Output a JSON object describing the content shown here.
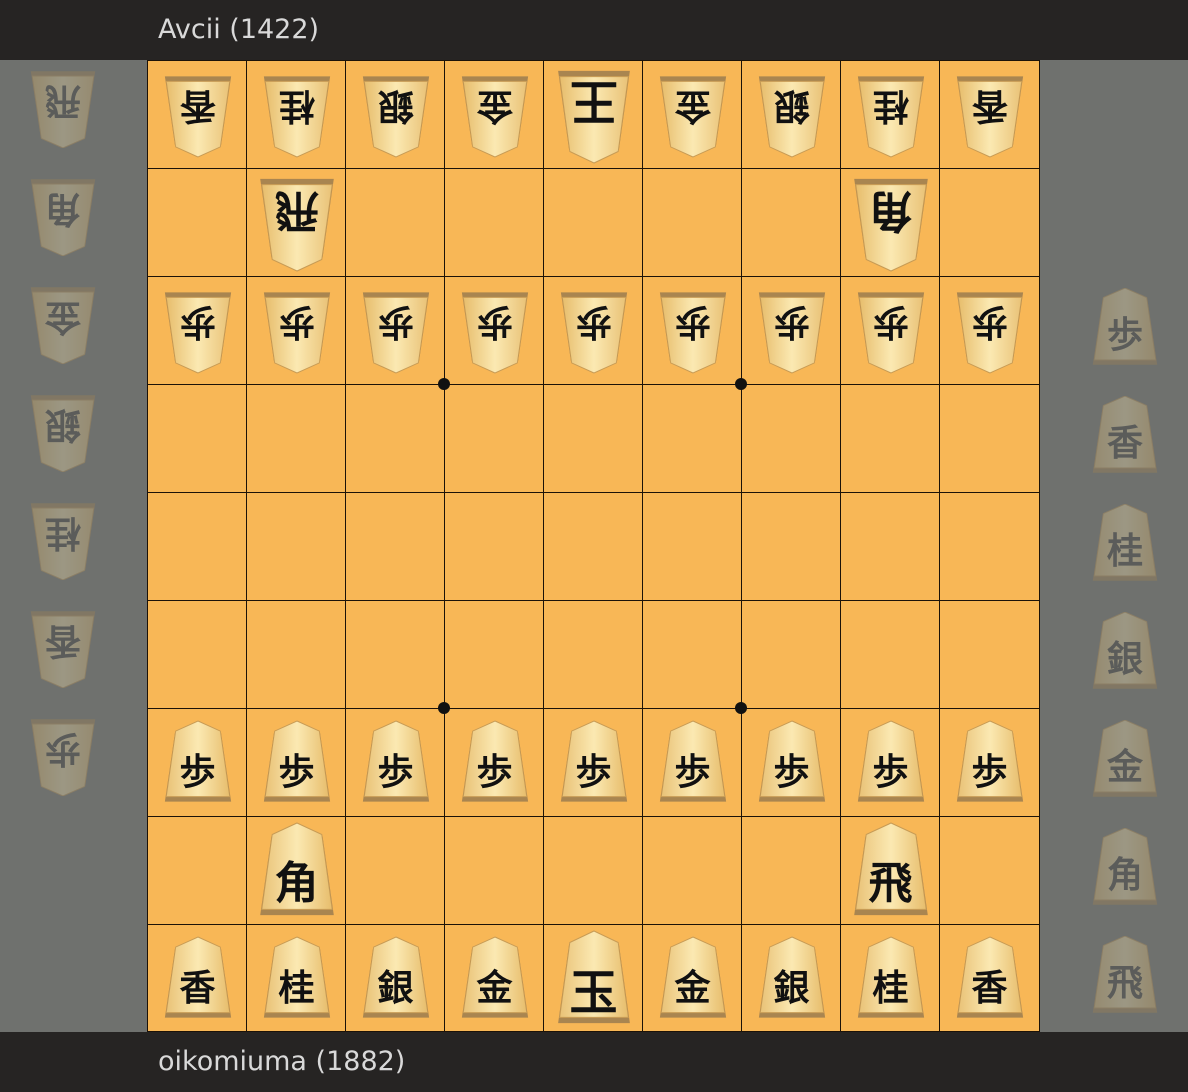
{
  "players": {
    "top": {
      "name": "Avcii",
      "rating": "(1422)",
      "label": "Avcii (1422)"
    },
    "bottom": {
      "name": "oikomiuma",
      "rating": "(1882)",
      "label": "oikomiuma (1882)"
    }
  },
  "board": {
    "files": 9,
    "ranks": 9,
    "colors": {
      "square": "#f8b756",
      "line": "#1c1208",
      "piece_light": "#fbe7a9",
      "piece_dark": "#e9c277",
      "background": "#6f716e",
      "bar": "#262423"
    },
    "pieces": [
      {
        "row": 0,
        "col": 0,
        "char": "香",
        "side": "gote"
      },
      {
        "row": 0,
        "col": 1,
        "char": "桂",
        "side": "gote"
      },
      {
        "row": 0,
        "col": 2,
        "char": "銀",
        "side": "gote"
      },
      {
        "row": 0,
        "col": 3,
        "char": "金",
        "side": "gote"
      },
      {
        "row": 0,
        "col": 4,
        "char": "王",
        "side": "gote",
        "king": true
      },
      {
        "row": 0,
        "col": 5,
        "char": "金",
        "side": "gote"
      },
      {
        "row": 0,
        "col": 6,
        "char": "銀",
        "side": "gote"
      },
      {
        "row": 0,
        "col": 7,
        "char": "桂",
        "side": "gote"
      },
      {
        "row": 0,
        "col": 8,
        "char": "香",
        "side": "gote"
      },
      {
        "row": 1,
        "col": 1,
        "char": "飛",
        "side": "gote",
        "major": true
      },
      {
        "row": 1,
        "col": 7,
        "char": "角",
        "side": "gote",
        "major": true
      },
      {
        "row": 2,
        "col": 0,
        "char": "歩",
        "side": "gote"
      },
      {
        "row": 2,
        "col": 1,
        "char": "歩",
        "side": "gote"
      },
      {
        "row": 2,
        "col": 2,
        "char": "歩",
        "side": "gote"
      },
      {
        "row": 2,
        "col": 3,
        "char": "歩",
        "side": "gote"
      },
      {
        "row": 2,
        "col": 4,
        "char": "歩",
        "side": "gote"
      },
      {
        "row": 2,
        "col": 5,
        "char": "歩",
        "side": "gote"
      },
      {
        "row": 2,
        "col": 6,
        "char": "歩",
        "side": "gote"
      },
      {
        "row": 2,
        "col": 7,
        "char": "歩",
        "side": "gote"
      },
      {
        "row": 2,
        "col": 8,
        "char": "歩",
        "side": "gote"
      },
      {
        "row": 6,
        "col": 0,
        "char": "歩",
        "side": "sente"
      },
      {
        "row": 6,
        "col": 1,
        "char": "歩",
        "side": "sente"
      },
      {
        "row": 6,
        "col": 2,
        "char": "歩",
        "side": "sente"
      },
      {
        "row": 6,
        "col": 3,
        "char": "歩",
        "side": "sente"
      },
      {
        "row": 6,
        "col": 4,
        "char": "歩",
        "side": "sente"
      },
      {
        "row": 6,
        "col": 5,
        "char": "歩",
        "side": "sente"
      },
      {
        "row": 6,
        "col": 6,
        "char": "歩",
        "side": "sente"
      },
      {
        "row": 6,
        "col": 7,
        "char": "歩",
        "side": "sente"
      },
      {
        "row": 6,
        "col": 8,
        "char": "歩",
        "side": "sente"
      },
      {
        "row": 7,
        "col": 1,
        "char": "角",
        "side": "sente",
        "major": true
      },
      {
        "row": 7,
        "col": 7,
        "char": "飛",
        "side": "sente",
        "major": true
      },
      {
        "row": 8,
        "col": 0,
        "char": "香",
        "side": "sente"
      },
      {
        "row": 8,
        "col": 1,
        "char": "桂",
        "side": "sente"
      },
      {
        "row": 8,
        "col": 2,
        "char": "銀",
        "side": "sente"
      },
      {
        "row": 8,
        "col": 3,
        "char": "金",
        "side": "sente"
      },
      {
        "row": 8,
        "col": 4,
        "char": "玉",
        "side": "sente",
        "king": true
      },
      {
        "row": 8,
        "col": 5,
        "char": "金",
        "side": "sente"
      },
      {
        "row": 8,
        "col": 6,
        "char": "銀",
        "side": "sente"
      },
      {
        "row": 8,
        "col": 7,
        "char": "桂",
        "side": "sente"
      },
      {
        "row": 8,
        "col": 8,
        "char": "香",
        "side": "sente"
      }
    ]
  },
  "hands": {
    "gote": [
      "飛",
      "角",
      "金",
      "銀",
      "桂",
      "香",
      "歩"
    ],
    "sente": [
      "歩",
      "香",
      "桂",
      "銀",
      "金",
      "角",
      "飛"
    ]
  }
}
